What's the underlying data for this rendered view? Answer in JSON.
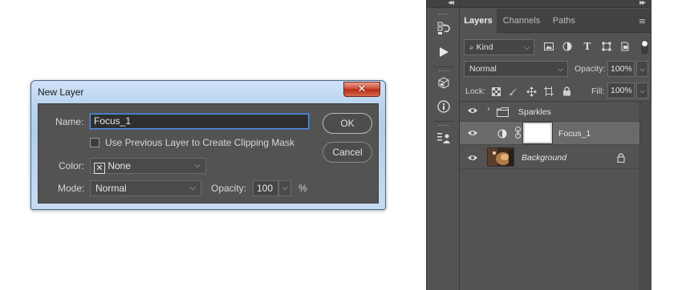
{
  "dialog": {
    "title": "New Layer",
    "close_glyph": "✕",
    "name_label": "Name:",
    "name_value": "Focus_1",
    "clipping_label": "Use Previous Layer to Create Clipping Mask",
    "color_label": "Color:",
    "color_glyph": "✕",
    "color_value": "None",
    "mode_label": "Mode:",
    "mode_value": "Normal",
    "opacity_label": "Opacity:",
    "opacity_value": "100",
    "opacity_unit": "%",
    "ok_label": "OK",
    "cancel_label": "Cancel"
  },
  "panel": {
    "collapse_left": "◂◂",
    "collapse_right": "▸▸",
    "tabs": [
      {
        "label": "Layers"
      },
      {
        "label": "Channels"
      },
      {
        "label": "Paths"
      }
    ],
    "menu_glyph": "≡",
    "filter_kind": "Kind",
    "blend_mode": "Normal",
    "opacity_label": "Opacity:",
    "opacity_value": "100%",
    "lock_label": "Lock:",
    "fill_label": "Fill:",
    "fill_value": "100%",
    "layers": [
      {
        "name": "Sparkles"
      },
      {
        "name": "Focus_1"
      },
      {
        "name": "Background"
      }
    ]
  },
  "colors": {
    "panel_bg": "#535353",
    "selected_row": "#6a6a6a",
    "dialog_frame": "#b9d3ee",
    "close_red": "#c8452d"
  }
}
